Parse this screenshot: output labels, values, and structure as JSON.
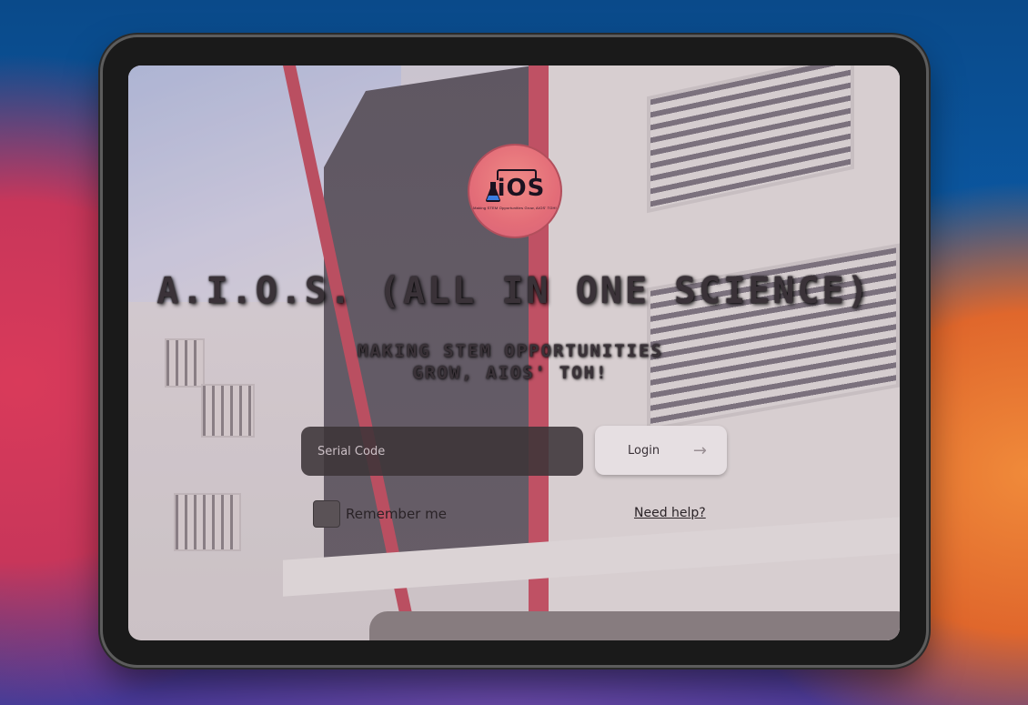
{
  "app": {
    "title": "A.I.O.S. (ALL IN ONE SCIENCE)",
    "tagline_line1": "MAKING STEM OPPORTUNITIES",
    "tagline_line2": "GROW, AIOS' TOH!",
    "logo_wordmark": "iOS",
    "logo_tag": "Making STEM Opportunities Grow, AIOS' TOH!"
  },
  "login_form": {
    "serial_placeholder": "Serial Code",
    "serial_value": "",
    "login_label": "Login",
    "remember_label": "Remember me",
    "remember_checked": false,
    "help_label": "Need help?"
  },
  "colors": {
    "logo_fill": "#e36d78",
    "input_bg": "#3c3438",
    "button_bg": "#e6dfe2",
    "text_dark": "#3a3238"
  }
}
